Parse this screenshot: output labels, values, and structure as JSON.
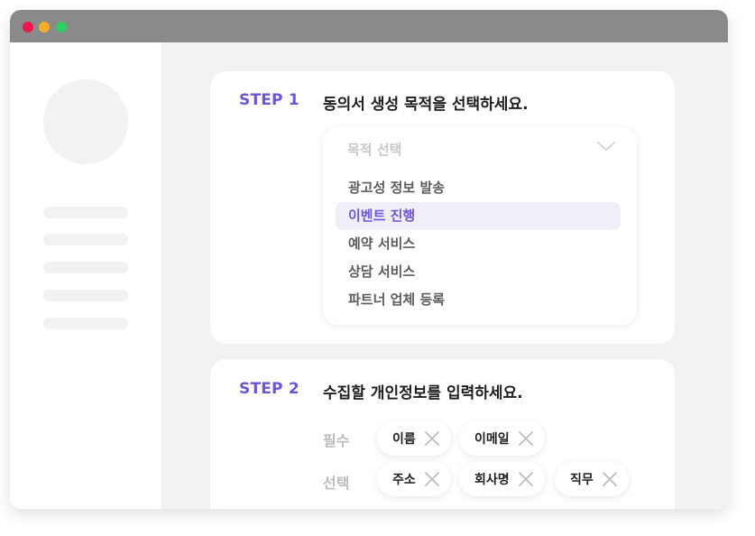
{
  "window": {
    "controls": [
      {
        "name": "close",
        "color": "#f0174f"
      },
      {
        "name": "minimize",
        "color": "#f5ad2a"
      },
      {
        "name": "maximize",
        "color": "#2fcf60"
      }
    ]
  },
  "step1": {
    "label": "STEP 1",
    "title": "동의서 생성 목적을 선택하세요.",
    "dropdown": {
      "placeholder": "목적 선택",
      "icon": "chevron-down-icon",
      "options": [
        "광고성 정보 발송",
        "이벤트 진행",
        "예약 서비스",
        "상담 서비스",
        "파트너 업체 등록"
      ],
      "highlighted_index": 1
    }
  },
  "step2": {
    "label": "STEP 2",
    "title": "수집할 개인정보를 입력하세요.",
    "required": {
      "label": "필수",
      "chips": [
        "이름",
        "이메일"
      ]
    },
    "optional": {
      "label": "선택",
      "chips": [
        "주소",
        "회사명",
        "직무"
      ]
    },
    "chip_icon": "close-icon"
  },
  "colors": {
    "accent": "#6e55d6",
    "titlebar": "#8a8a8a",
    "highlight_bg": "#f0eff8"
  }
}
